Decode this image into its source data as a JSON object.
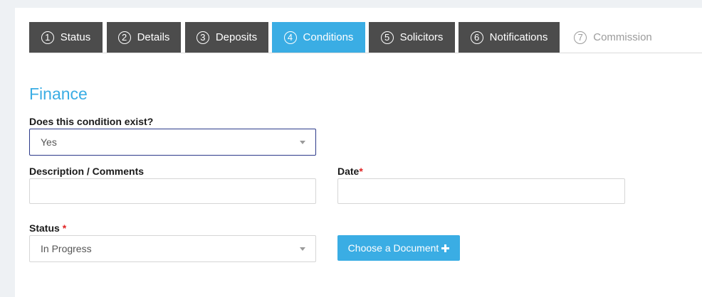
{
  "tabs": [
    {
      "num": "1",
      "label": "Status",
      "state": "done"
    },
    {
      "num": "2",
      "label": "Details",
      "state": "done"
    },
    {
      "num": "3",
      "label": "Deposits",
      "state": "done"
    },
    {
      "num": "4",
      "label": "Conditions",
      "state": "active"
    },
    {
      "num": "5",
      "label": "Solicitors",
      "state": "done"
    },
    {
      "num": "6",
      "label": "Notifications",
      "state": "done"
    },
    {
      "num": "7",
      "label": "Commission",
      "state": "disabled"
    }
  ],
  "section": {
    "title": "Finance"
  },
  "form": {
    "exists_label": "Does this condition exist?",
    "exists_value": "Yes",
    "description_label": "Description / Comments",
    "description_value": "",
    "date_label": "Date",
    "date_value": "",
    "status_label": "Status",
    "status_value": "In Progress",
    "required_marker": "*",
    "choose_document_label": "Choose a Document"
  },
  "colors": {
    "accent": "#3aade4",
    "tab_dark": "#4c4c4c",
    "required": "#e02424"
  }
}
